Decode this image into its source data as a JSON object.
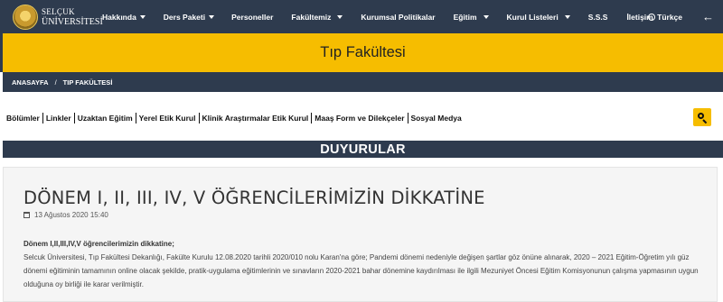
{
  "logo": {
    "line1": "SELÇUK",
    "line2": "ÜNİVERSİTESİ"
  },
  "nav": [
    {
      "label": "Hakkında",
      "dropdown": true
    },
    {
      "label": "Ders Paketi",
      "dropdown": true
    },
    {
      "label": "Personeller",
      "dropdown": false
    },
    {
      "label": "Fakültemiz",
      "dropdown": true
    },
    {
      "label": "Kurumsal Politikalar",
      "dropdown": false
    },
    {
      "label": "Eğitim",
      "dropdown": true
    },
    {
      "label": "Kurul Listeleri",
      "dropdown": true
    },
    {
      "label": "S.S.S",
      "dropdown": false
    },
    {
      "label": "İletişim",
      "dropdown": false
    }
  ],
  "language": "Türkçe",
  "page_title": "Tıp Fakültesi",
  "breadcrumb": [
    "ANASAYFA",
    "TIP FAKÜLTESİ"
  ],
  "quick_links": [
    "Bölümler",
    "Linkler",
    "Uzaktan Eğitim",
    "Yerel Etik Kurul",
    "Klinik Araştırmalar Etik Kurul",
    "Maaş Form ve Dilekçeler",
    "Sosyal Medya"
  ],
  "section_title": "DUYURULAR",
  "announcement": {
    "title": "DÖNEM I, II, III, IV, V ÖĞRENCİLERİMİZİN DİKKATİNE",
    "date": "13 Ağustos 2020 15:40",
    "lead": "Dönem I,II,III,IV,V öğrencilerimizin dikkatine;",
    "body": "Selcuk Üniversitesi, Tıp Fakültesi Dekanlığı, Fakülte Kurulu 12.08.2020 tarihli 2020/010 nolu Karan'na göre; Pandemi dönemi nedeniyle değişen şartlar göz önüne alınarak, 2020 – 2021 Eğitim-Öğretim yılı güz dönemi eğitiminin tamamının online olacak şekilde, pratik-uygulama eğitimlerinin ve sınavların 2020-2021 bahar dönemine kaydırılması ile ilgili Mezuniyet Öncesi Eğitim Komisyonunun çalışma yapmasının uygun olduğuna oy birliği ile karar verilmiştir."
  },
  "colors": {
    "navy": "#2e3b4e",
    "accent": "#f6bd00"
  },
  "icons": {
    "language": "globe-icon",
    "back": "back-arrow-icon",
    "search": "search-icon",
    "date": "calendar-icon"
  }
}
